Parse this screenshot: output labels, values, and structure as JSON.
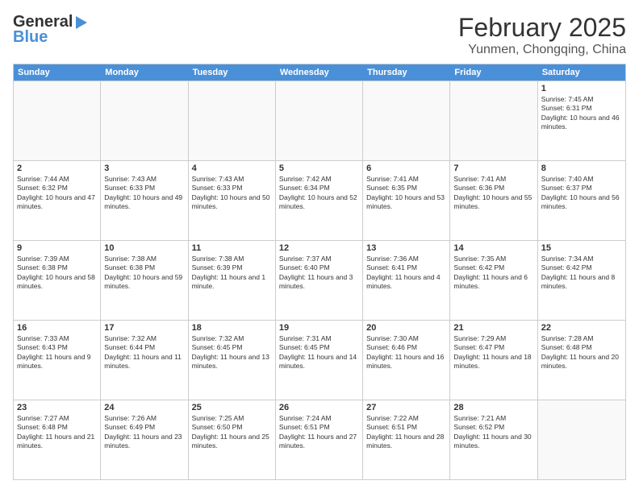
{
  "header": {
    "logo_general": "General",
    "logo_blue": "Blue",
    "month_title": "February 2025",
    "location": "Yunmen, Chongqing, China"
  },
  "calendar": {
    "days_of_week": [
      "Sunday",
      "Monday",
      "Tuesday",
      "Wednesday",
      "Thursday",
      "Friday",
      "Saturday"
    ],
    "weeks": [
      [
        {
          "day": "",
          "info": ""
        },
        {
          "day": "",
          "info": ""
        },
        {
          "day": "",
          "info": ""
        },
        {
          "day": "",
          "info": ""
        },
        {
          "day": "",
          "info": ""
        },
        {
          "day": "",
          "info": ""
        },
        {
          "day": "1",
          "info": "Sunrise: 7:45 AM\nSunset: 6:31 PM\nDaylight: 10 hours and 46 minutes."
        }
      ],
      [
        {
          "day": "2",
          "info": "Sunrise: 7:44 AM\nSunset: 6:32 PM\nDaylight: 10 hours and 47 minutes."
        },
        {
          "day": "3",
          "info": "Sunrise: 7:43 AM\nSunset: 6:33 PM\nDaylight: 10 hours and 49 minutes."
        },
        {
          "day": "4",
          "info": "Sunrise: 7:43 AM\nSunset: 6:33 PM\nDaylight: 10 hours and 50 minutes."
        },
        {
          "day": "5",
          "info": "Sunrise: 7:42 AM\nSunset: 6:34 PM\nDaylight: 10 hours and 52 minutes."
        },
        {
          "day": "6",
          "info": "Sunrise: 7:41 AM\nSunset: 6:35 PM\nDaylight: 10 hours and 53 minutes."
        },
        {
          "day": "7",
          "info": "Sunrise: 7:41 AM\nSunset: 6:36 PM\nDaylight: 10 hours and 55 minutes."
        },
        {
          "day": "8",
          "info": "Sunrise: 7:40 AM\nSunset: 6:37 PM\nDaylight: 10 hours and 56 minutes."
        }
      ],
      [
        {
          "day": "9",
          "info": "Sunrise: 7:39 AM\nSunset: 6:38 PM\nDaylight: 10 hours and 58 minutes."
        },
        {
          "day": "10",
          "info": "Sunrise: 7:38 AM\nSunset: 6:38 PM\nDaylight: 10 hours and 59 minutes."
        },
        {
          "day": "11",
          "info": "Sunrise: 7:38 AM\nSunset: 6:39 PM\nDaylight: 11 hours and 1 minute."
        },
        {
          "day": "12",
          "info": "Sunrise: 7:37 AM\nSunset: 6:40 PM\nDaylight: 11 hours and 3 minutes."
        },
        {
          "day": "13",
          "info": "Sunrise: 7:36 AM\nSunset: 6:41 PM\nDaylight: 11 hours and 4 minutes."
        },
        {
          "day": "14",
          "info": "Sunrise: 7:35 AM\nSunset: 6:42 PM\nDaylight: 11 hours and 6 minutes."
        },
        {
          "day": "15",
          "info": "Sunrise: 7:34 AM\nSunset: 6:42 PM\nDaylight: 11 hours and 8 minutes."
        }
      ],
      [
        {
          "day": "16",
          "info": "Sunrise: 7:33 AM\nSunset: 6:43 PM\nDaylight: 11 hours and 9 minutes."
        },
        {
          "day": "17",
          "info": "Sunrise: 7:32 AM\nSunset: 6:44 PM\nDaylight: 11 hours and 11 minutes."
        },
        {
          "day": "18",
          "info": "Sunrise: 7:32 AM\nSunset: 6:45 PM\nDaylight: 11 hours and 13 minutes."
        },
        {
          "day": "19",
          "info": "Sunrise: 7:31 AM\nSunset: 6:45 PM\nDaylight: 11 hours and 14 minutes."
        },
        {
          "day": "20",
          "info": "Sunrise: 7:30 AM\nSunset: 6:46 PM\nDaylight: 11 hours and 16 minutes."
        },
        {
          "day": "21",
          "info": "Sunrise: 7:29 AM\nSunset: 6:47 PM\nDaylight: 11 hours and 18 minutes."
        },
        {
          "day": "22",
          "info": "Sunrise: 7:28 AM\nSunset: 6:48 PM\nDaylight: 11 hours and 20 minutes."
        }
      ],
      [
        {
          "day": "23",
          "info": "Sunrise: 7:27 AM\nSunset: 6:48 PM\nDaylight: 11 hours and 21 minutes."
        },
        {
          "day": "24",
          "info": "Sunrise: 7:26 AM\nSunset: 6:49 PM\nDaylight: 11 hours and 23 minutes."
        },
        {
          "day": "25",
          "info": "Sunrise: 7:25 AM\nSunset: 6:50 PM\nDaylight: 11 hours and 25 minutes."
        },
        {
          "day": "26",
          "info": "Sunrise: 7:24 AM\nSunset: 6:51 PM\nDaylight: 11 hours and 27 minutes."
        },
        {
          "day": "27",
          "info": "Sunrise: 7:22 AM\nSunset: 6:51 PM\nDaylight: 11 hours and 28 minutes."
        },
        {
          "day": "28",
          "info": "Sunrise: 7:21 AM\nSunset: 6:52 PM\nDaylight: 11 hours and 30 minutes."
        },
        {
          "day": "",
          "info": ""
        }
      ]
    ]
  }
}
